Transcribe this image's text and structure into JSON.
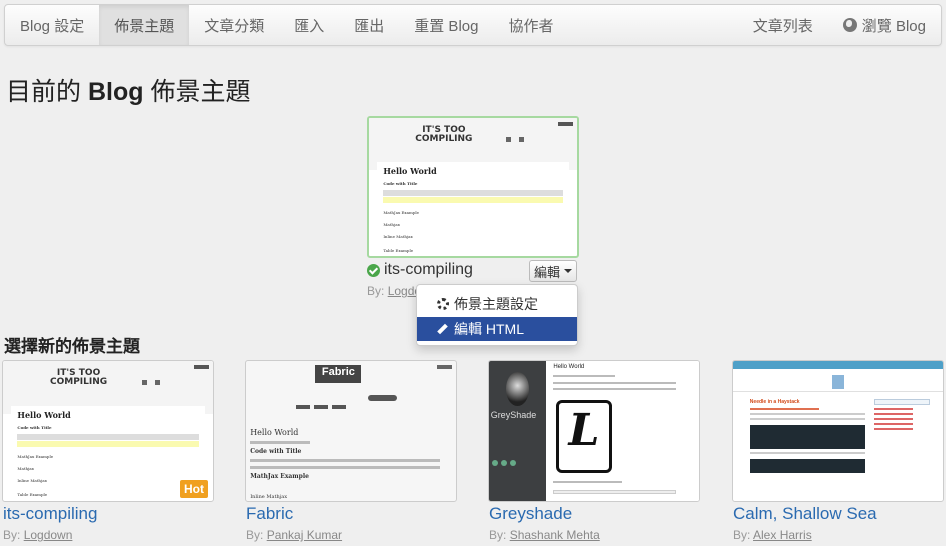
{
  "nav": {
    "left": [
      "Blog 設定",
      "佈景主題",
      "文章分類",
      "匯入",
      "匯出",
      "重置 Blog",
      "協作者"
    ],
    "right": [
      "文章列表",
      "瀏覽 Blog"
    ]
  },
  "page_title_prefix": "目前的",
  "page_title_bold": "Blog",
  "page_title_suffix": "佈景主題",
  "current_theme": {
    "name": "its-compiling",
    "by_label": "By:",
    "author": "Logdown",
    "edit_label": "編輯",
    "preview": {
      "logo_line1": "IT'S TOO",
      "logo_line2": "COMPILING",
      "post_title": "Hello World",
      "subtitle": "Code with Title",
      "lines": [
        "MathJax Example",
        "Mathjax",
        "Inline Mathjax",
        "Table Example"
      ]
    }
  },
  "dropdown": {
    "items": [
      "佈景主題設定",
      "編輯 HTML"
    ]
  },
  "section_title": "選擇新的佈景主題",
  "themes": [
    {
      "name": "its-compiling",
      "by_label": "By:",
      "author": "Logdown",
      "badge": "Hot"
    },
    {
      "name": "Fabric",
      "by_label": "By:",
      "author": "Pankaj Kumar",
      "logo": "Fabric",
      "post_title": "Hello World",
      "subtitle": "Code with Title",
      "lines": [
        "MathJax Example",
        "Inline Mathjax"
      ]
    },
    {
      "name": "Greyshade",
      "by_label": "By:",
      "author": "Shashank Mehta",
      "side_name": "GreyShade",
      "post_title": "Hello World"
    },
    {
      "name": "Calm, Shallow Sea",
      "by_label": "By:",
      "author": "Alex Harris",
      "post_title": "Needle in a Haystack"
    }
  ],
  "colors": {
    "link": "#2a6ab0",
    "dropdown_highlight": "#2a4f9e",
    "hot_badge": "#f0a020",
    "active_check": "#4aa64a"
  }
}
